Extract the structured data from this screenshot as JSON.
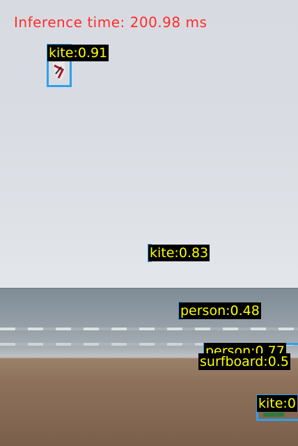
{
  "inference_text": "Inference time: 200.98 ms",
  "colors": {
    "box": "#2fa0ea",
    "label_text": "#ffff00",
    "label_bg": "#000000",
    "inference_text": "#ff2b2b"
  },
  "detections": [
    {
      "label": "kite:0.91"
    },
    {
      "label": "kite:0.83"
    },
    {
      "label": "person:0.48"
    },
    {
      "label": "person:0.77"
    },
    {
      "label": "surfboard:0.5"
    },
    {
      "label": "kite:0"
    }
  ]
}
